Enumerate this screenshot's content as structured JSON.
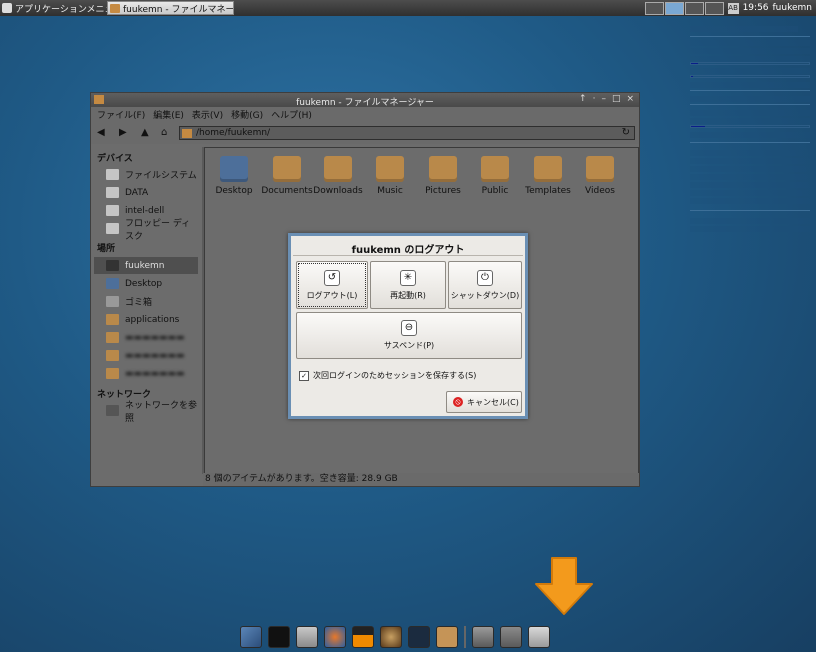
{
  "top_panel": {
    "apps_menu_label": "アプリケーションメニュー",
    "task_button_label": "fuukemn - ファイルマネージ…",
    "keyboard_label": "AB",
    "clock": "19:56",
    "user": "fuukemn"
  },
  "file_manager": {
    "title": "fuukemn - ファイルマネージャー",
    "menus": [
      "ファイル(F)",
      "編集(E)",
      "表示(V)",
      "移動(G)",
      "ヘルプ(H)"
    ],
    "path": "/home/fuukemn/",
    "sidebar": {
      "devices_header": "デバイス",
      "devices": [
        "ファイルシステム",
        "DATA",
        "intel-dell",
        "フロッピー ディスク"
      ],
      "places_header": "場所",
      "places": [
        "fuukemn",
        "Desktop",
        "ゴミ箱",
        "applications"
      ],
      "network_header": "ネットワーク",
      "network": [
        "ネットワークを参照"
      ]
    },
    "files": [
      "Desktop",
      "Documents",
      "Downloads",
      "Music",
      "Pictures",
      "Public",
      "Templates",
      "Videos"
    ],
    "status": "8 個のアイテムがあります。空き容量: 28.9 GB"
  },
  "logout_dialog": {
    "title": "fuukemn のログアウト",
    "logout_label": "ログアウト(L)",
    "restart_label": "再起動(R)",
    "shutdown_label": "シャットダウン(D)",
    "suspend_label": "サスペンド(P)",
    "save_session_label": "次回ログインのためセッションを保存する(S)",
    "save_session_checked": true,
    "cancel_label": "キャンセル(C)"
  },
  "colors": {
    "desktop": "#1f5a86",
    "dialog_border": "#6a8fb4",
    "arrow": "#f39a1c"
  }
}
